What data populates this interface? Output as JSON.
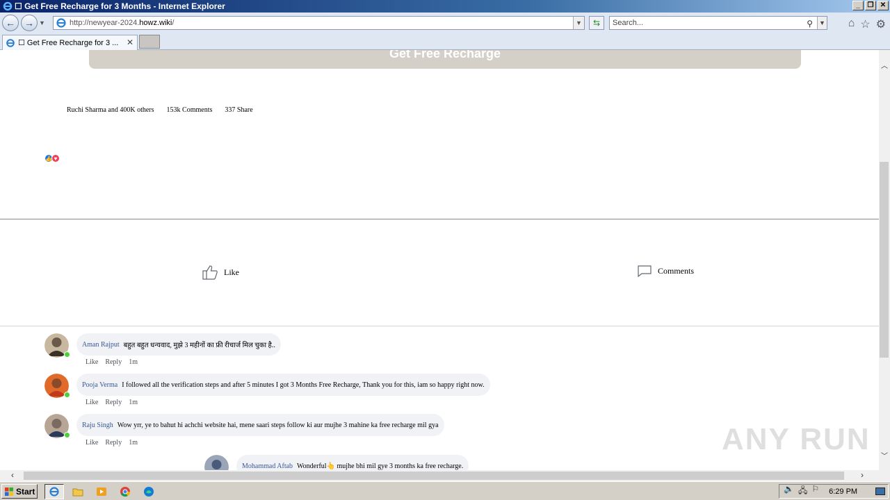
{
  "window": {
    "title": "☐ Get Free Recharge for 3 Months - Internet Explorer",
    "controls": [
      "_",
      "❐",
      "✕"
    ]
  },
  "nav": {
    "url_prefix": "http://newyear-2024.",
    "url_host": "howz.wiki",
    "url_suffix": "/",
    "search_placeholder": "Search..."
  },
  "tabs": [
    {
      "label": "☐ Get Free Recharge for 3 ..."
    }
  ],
  "page": {
    "recharge_button": "Get Free Recharge",
    "stats": {
      "likes": "Ruchi Sharma and 400K others",
      "comments": "153k  Comments",
      "shares": "337  Share"
    },
    "actions": {
      "like": "Like",
      "comments": "Comments"
    },
    "comments": [
      {
        "name": "Aman Rajput",
        "text": "बहुत बहुत धन्यवाद, मुझे 3 महीनों का फ्री रीचार्ज मिल चुका है..",
        "like": "Like",
        "reply": "Reply",
        "time": "1m",
        "avatar_color": "#6b5a4a"
      },
      {
        "name": "Pooja Verma",
        "text": "I followed all the verification steps and after 5 minutes I got 3 Months Free Recharge, Thank you for this, iam so happy right now.",
        "like": "Like",
        "reply": "Reply",
        "time": "1m",
        "avatar_color": "#d4541a"
      },
      {
        "name": "Raju Singh",
        "text": "Wow yrr, ye to bahut hi achchi website hai, mene saari steps follow ki aur mujhe 3 mahine ka free recharge mil gya",
        "like": "Like",
        "reply": "Reply",
        "time": "1m",
        "avatar_color": "#7a6a60"
      },
      {
        "name": "Mohammad Aftab",
        "text": "Wonderful👆 mujhe bhi mil gye 3 months ka free recharge.",
        "avatar_color": "#4a5a7a"
      }
    ],
    "watermark": "ANY RUN"
  },
  "taskbar": {
    "start": "Start",
    "clock": "6:29 PM"
  },
  "colors": {
    "title_gradient_start": "#0a246a",
    "link_blue": "#385898",
    "bubble_bg": "#f0f2f5",
    "recharge_bg": "#d4d0c8",
    "online": "#4cd137"
  }
}
